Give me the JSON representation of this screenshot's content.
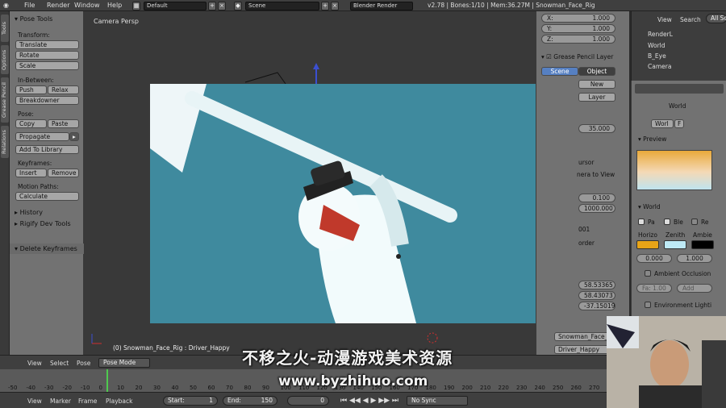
{
  "menu": {
    "file": "File",
    "render": "Render",
    "window": "Window",
    "help": "Help"
  },
  "screen_layout": "Default",
  "scene_name": "Scene",
  "render_engine": "Blender Render",
  "stats": "v2.78 | Bones:1/10 | Mem:36.27M | Snowman_Face_Rig",
  "left_tabs": [
    "Tools",
    "Options",
    "Grease Pencil",
    "Relations"
  ],
  "tool_shelf": {
    "title": "Pose Tools",
    "transform_label": "Transform:",
    "translate": "Translate",
    "rotate": "Rotate",
    "scale": "Scale",
    "inbetween_label": "In-Between:",
    "push": "Push",
    "relax": "Relax",
    "breakdowner": "Breakdowner",
    "pose_label": "Pose:",
    "copy": "Copy",
    "paste": "Paste",
    "propagate": "Propagate",
    "add_to_library": "Add To Library",
    "keyframes_label": "Keyframes:",
    "insert": "Insert",
    "remove": "Remove",
    "motion_paths_label": "Motion Paths:",
    "calculate": "Calculate",
    "history": "History",
    "rigify": "Rigify Dev Tools",
    "delete_keyframes": "Delete Keyframes"
  },
  "viewport": {
    "title": "Camera Persp",
    "status": "(0) Snowman_Face_Rig : Driver_Happy"
  },
  "n_panel": {
    "x": "X:",
    "x_val": "1.000",
    "y": "Y:",
    "y_val": "1.000",
    "z": "Z:",
    "z_val": "1.000",
    "grease_pencil": "Grease Pencil Layer",
    "scene_tab": "Scene",
    "object_tab": "Object",
    "new": "New",
    "layer": "Layer",
    "val_35": "35.000",
    "cursor": "ursor",
    "to_view": "nera to View",
    "val_0100": "0.100",
    "val_1000": "1000.000",
    "val_001": "001",
    "border": "order",
    "loc_a": "58.53365",
    "loc_b": "58.43073",
    "loc_c": "-37.15019",
    "obj_name": "Snowman_Face_Ri",
    "bone_name": "Driver_Happy"
  },
  "outliner": {
    "view": "View",
    "search": "Search",
    "all_scenes": "All Sc",
    "rows": [
      "RenderL",
      "World",
      "B_Eye",
      "Camera"
    ]
  },
  "properties": {
    "world_label": "World",
    "world_field": "Worl",
    "world_f": "F",
    "preview": "Preview",
    "world_panel": "World",
    "paper": "Pa",
    "blend": "Ble",
    "real": "Re",
    "horizon": "Horizo",
    "zenith": "Zenith",
    "ambient": "Ambie",
    "horizon_color": "#e8a417",
    "zenith_color": "#bde9f5",
    "ambient_color": "#000000",
    "val_0": "0.000",
    "val_1": "1.000",
    "ambient_occlusion": "Ambient Occlusion",
    "fa": "Fa: 1.00",
    "add": "Add",
    "env_light": "Environment Lighti"
  },
  "timeline": {
    "view": "View",
    "select": "Select",
    "pose": "Pose",
    "mode": "Pose Mode",
    "ticks": [
      "-50",
      "-40",
      "-30",
      "-20",
      "-10",
      "0",
      "10",
      "20",
      "30",
      "40",
      "50",
      "60",
      "70",
      "80",
      "90",
      "100",
      "110",
      "120",
      "130",
      "140",
      "150",
      "160",
      "170",
      "180",
      "190",
      "200",
      "210",
      "220",
      "230",
      "240",
      "250",
      "260",
      "270"
    ],
    "bottom_view": "View",
    "marker": "Marker",
    "frame": "Frame",
    "playback": "Playback",
    "start": "Start:",
    "start_val": "1",
    "end": "End:",
    "end_val": "150",
    "current": "0",
    "sync": "No Sync"
  },
  "watermark": {
    "line1": "不移之火-动漫游戏美术资源",
    "line2": "www.byzhihuo.com"
  }
}
